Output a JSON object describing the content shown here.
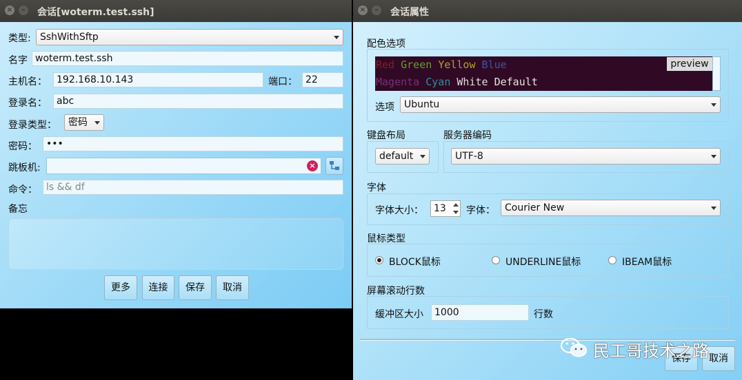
{
  "left_window": {
    "title": "会话[woterm.test.ssh]",
    "type_label": "类型:",
    "type_value": "SshWithSftp",
    "name_label": "名字",
    "name_value": "woterm.test.ssh",
    "host_label": "主机名：",
    "host_value": "192.168.10.143",
    "port_label": "端口：",
    "port_value": "22",
    "login_label": "登录名：",
    "login_value": "abc",
    "login_type_label": "登录类型：",
    "login_type_value": "密码",
    "password_label": "密码：",
    "password_value": "•••",
    "jump_label": "跳板机:",
    "jump_value": "",
    "command_label": "命令：",
    "command_placeholder": "ls && df",
    "memo_label": "备忘",
    "buttons": {
      "more": "更多",
      "connect": "连接",
      "save": "保存",
      "cancel": "取消"
    }
  },
  "right_window": {
    "title": "会话属性",
    "color_section": "配色选项",
    "preview_button": "preview",
    "preview_colors": [
      {
        "name": "Red",
        "color": "#8a1e1e"
      },
      {
        "name": "Green",
        "color": "#6f9a2a"
      },
      {
        "name": "Yellow",
        "color": "#b4a023"
      },
      {
        "name": "Blue",
        "color": "#3e56a6"
      },
      {
        "name": "Magenta",
        "color": "#7a2e7a"
      },
      {
        "name": "Cyan",
        "color": "#2f8f9c"
      },
      {
        "name": "White",
        "color": "#e0dcd8"
      },
      {
        "name": "Default",
        "color": "#e8e4e2"
      }
    ],
    "preview_bg": "#300a24",
    "scheme_label": "选项",
    "scheme_value": "Ubuntu",
    "keyboard_section": "键盘布局",
    "keyboard_value": "default",
    "encoding_section": "服务器编码",
    "encoding_value": "UTF-8",
    "font_section": "字体",
    "font_size_label": "字体大小：",
    "font_size_value": "13",
    "font_label": "字体：",
    "font_value": "Courier New",
    "cursor_section": "鼠标类型",
    "cursor_options": [
      "BLOCK鼠标",
      "UNDERLINE鼠标",
      "IBEAM鼠标"
    ],
    "cursor_selected": "BLOCK鼠标",
    "scroll_section": "屏幕滚动行数",
    "buffer_label": "缓冲区大小",
    "buffer_value": "1000",
    "buffer_unit": "行数",
    "buttons": {
      "save": "保存",
      "cancel": "取消"
    }
  },
  "watermark": "民工哥技术之路"
}
